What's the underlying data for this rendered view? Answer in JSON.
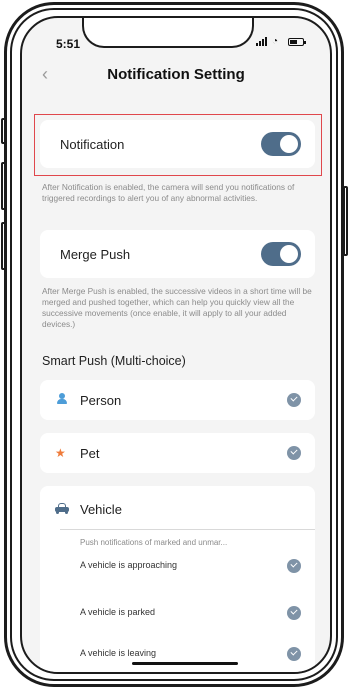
{
  "status_bar": {
    "time": "5:51"
  },
  "header": {
    "back_icon": "chevron-left-icon",
    "title": "Notification Setting"
  },
  "notification": {
    "label": "Notification",
    "enabled": true,
    "description": "After Notification is enabled, the camera will send you notifications of triggered recordings to alert you of any abnormal activities."
  },
  "merge_push": {
    "label": "Merge Push",
    "enabled": true,
    "description": "After Merge Push is enabled, the successive videos in a short time will be merged and pushed together, which can help you quickly view all the successive movements (once enable, it will apply to all your added devices.)"
  },
  "smart_push": {
    "title": "Smart Push (Multi-choice)",
    "items": [
      {
        "label": "Person",
        "icon": "person-icon",
        "checked": true
      },
      {
        "label": "Pet",
        "icon": "pet-icon",
        "checked": true
      },
      {
        "label": "Vehicle",
        "icon": "vehicle-icon",
        "checked": false
      }
    ],
    "vehicle_description": "Push notifications of marked and unmar...",
    "vehicle_options": [
      {
        "label": "A vehicle is approaching",
        "checked": true
      },
      {
        "label": "A vehicle is parked",
        "checked": true
      },
      {
        "label": "A vehicle is leaving",
        "checked": true
      }
    ]
  },
  "colors": {
    "accent": "#4f6d8a",
    "check": "#7f93a7",
    "highlight": "#e0474c",
    "person": "#4d9dd8",
    "pet": "#ef7b3a"
  }
}
